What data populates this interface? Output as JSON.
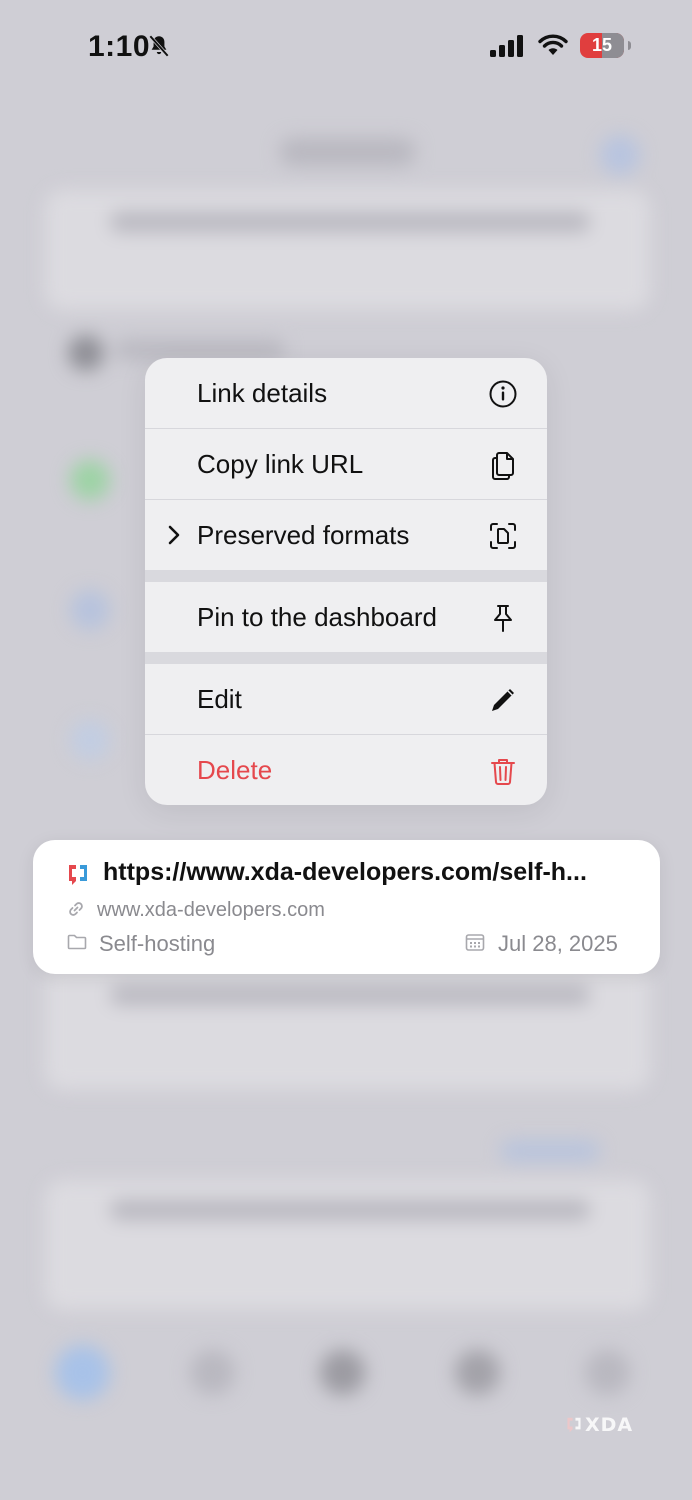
{
  "status_bar": {
    "time": "1:10",
    "battery_level": "15",
    "icons": [
      "bell-slash-icon",
      "cellular-signal-icon",
      "wifi-icon",
      "battery-icon"
    ]
  },
  "context_menu": {
    "items": [
      {
        "label": "Link details",
        "icon": "info-circle-icon"
      },
      {
        "label": "Copy link URL",
        "icon": "copy-documents-icon"
      },
      {
        "label": "Preserved formats",
        "icon": "scan-document-icon",
        "has_submenu": true
      },
      {
        "label": "Pin to the dashboard",
        "icon": "pin-icon"
      },
      {
        "label": "Edit",
        "icon": "pencil-icon"
      },
      {
        "label": "Delete",
        "icon": "trash-icon",
        "destructive": true
      }
    ]
  },
  "link_preview": {
    "url": "https://www.xda-developers.com/self-h...",
    "domain": "www.xda-developers.com",
    "collection": "Self-hosting",
    "date": "Jul 28, 2025"
  },
  "watermark": {
    "text": "XDA"
  },
  "colors": {
    "destructive": "#e5484d",
    "menu_background": "#efeff1",
    "backdrop": "#cfced5",
    "secondary_text": "#8a8a8f"
  }
}
